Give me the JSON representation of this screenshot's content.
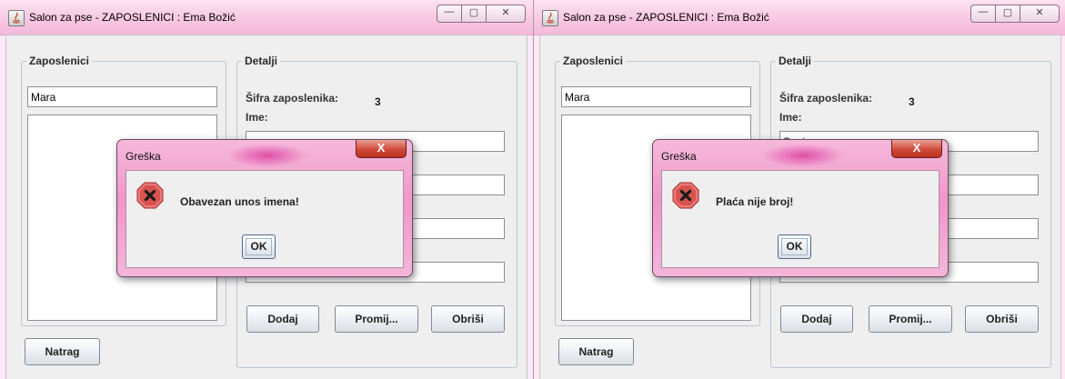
{
  "window1": {
    "title": "Salon za pse - ZAPOSLENICI : Ema Božić",
    "window_controls": {
      "minimize": "—",
      "maximize": "▢",
      "close": "✕"
    },
    "employees_group": "Zaposlenici",
    "search_value": "Mara",
    "details_group": "Detalji",
    "employee_id_label": "Šifra zaposlenika:",
    "employee_id_value": "3",
    "name_label": "Ime:",
    "add_button": "Dodaj",
    "modify_button": "Promij...",
    "delete_button": "Obriši",
    "back_button": "Natrag",
    "dialog": {
      "title": "Greška",
      "close_glyph": "X",
      "message": "Obavezan unos imena!",
      "ok_label": "OK"
    }
  },
  "window2": {
    "title": "Salon za pse - ZAPOSLENICI : Ema Božić",
    "window_controls": {
      "minimize": "—",
      "maximize": "▢",
      "close": "✕"
    },
    "employees_group": "Zaposlenici",
    "search_value": "Mara",
    "details_group": "Detalji",
    "employee_id_label": "Šifra zaposlenika:",
    "employee_id_value": "3",
    "name_label": "Ime:",
    "name_value": "Sonja",
    "add_button": "Dodaj",
    "modify_button": "Promij...",
    "delete_button": "Obriši",
    "back_button": "Natrag",
    "dialog": {
      "title": "Greška",
      "close_glyph": "X",
      "message": "Plaća nije broj!",
      "ok_label": "OK"
    }
  },
  "colors": {
    "titlebar": "#f7c6e2",
    "dialog_frame": "#ef97c8",
    "error_icon": "#d8534f",
    "client_bg": "#efefef"
  }
}
